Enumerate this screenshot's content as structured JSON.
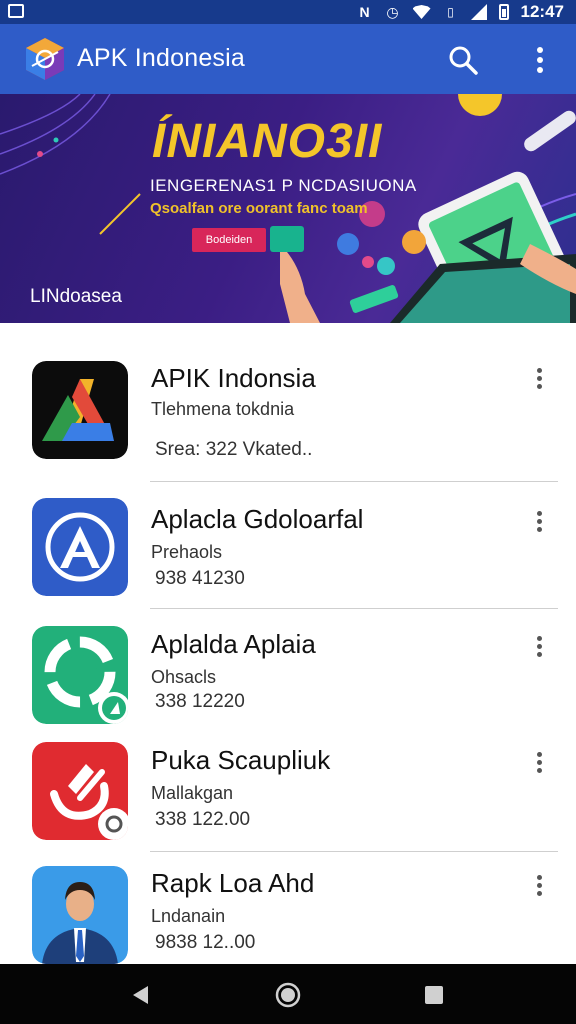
{
  "status_bar": {
    "time": "12:47",
    "icons": [
      "gallery-icon",
      "nfc-icon",
      "alarm-icon",
      "wifi-icon",
      "signal-icon",
      "battery-icon"
    ]
  },
  "app_bar": {
    "title": "APK Indonesia",
    "color": "#2f5cc8"
  },
  "banner": {
    "headline": "ÍNIANO3II",
    "subtitle": "IENGERENAS1 P NCDASIUONA",
    "tagline": "Qsoalfan ore oorant fanc toam",
    "button_label": "Bodeiden",
    "brand": "LINdoasea"
  },
  "apps": [
    {
      "title": "APIK Indonsia",
      "subtitle": "Tlehmena tokdnia",
      "meta": "Srea: 322 Vkated..",
      "icon": "apk-logo-icon"
    },
    {
      "title": "Aplacla Gdoloarfal",
      "subtitle": "Prehaols",
      "meta": "938 41230",
      "icon": "a-circle-icon"
    },
    {
      "title": "Aplalda Aplaia",
      "subtitle": "Ohsacls",
      "meta": "338 12220",
      "icon": "green-circle-icon"
    },
    {
      "title": "Puka Scaupliuk",
      "subtitle": "Mallakgan",
      "meta": "338 122.00",
      "icon": "red-swirl-icon"
    },
    {
      "title": "Rapk Loa Ahd",
      "subtitle": "Lndanain",
      "meta": "9838 12..00",
      "icon": "person-icon"
    }
  ],
  "nav": {
    "icons": [
      "back-icon",
      "home-icon",
      "recents-icon"
    ]
  }
}
